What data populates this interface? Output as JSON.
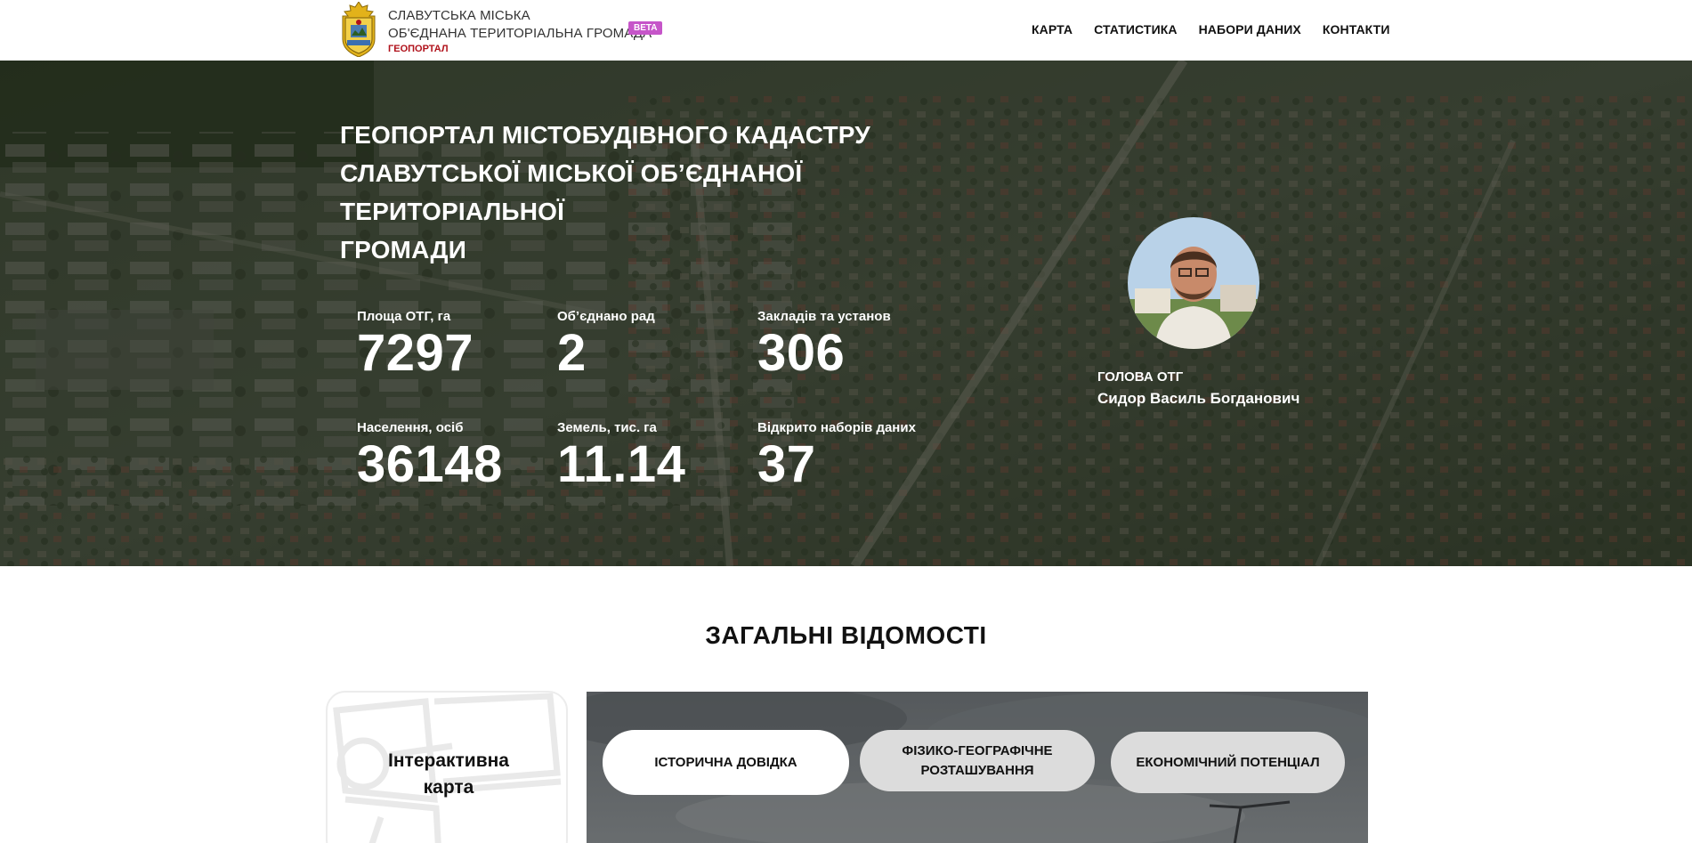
{
  "header": {
    "org_line1": "СЛАВУТСЬКА МІСЬКА",
    "org_line2": "ОБ'ЄДНАНА ТЕРИТОРІАЛЬНА ГРОМАДА",
    "org_sub": "ГЕОПОРТАЛ",
    "beta": "BETA",
    "nav": [
      "КАРТА",
      "СТАТИСТИКА",
      "НАБОРИ ДАНИХ",
      "КОНТАКТИ"
    ]
  },
  "hero": {
    "title_line1": "ГЕОПОРТАЛ МІСТОБУДІВНОГО КАДАСТРУ",
    "title_line2": "СЛАВУТСЬКОЇ МІСЬКОЇ ОБ’ЄДНАНОЇ ТЕРИТОРІАЛЬНОЇ",
    "title_line3": "ГРОМАДИ",
    "stats": [
      {
        "label": "Площа ОТГ, га",
        "value": "7297"
      },
      {
        "label": "Об’єднано рад",
        "value": "2"
      },
      {
        "label": "Закладів та установ",
        "value": "306"
      },
      {
        "label": "Населення, осіб",
        "value": "36148"
      },
      {
        "label": "Земель, тис. га",
        "value": "11.14"
      },
      {
        "label": "Відкрито наборів даних",
        "value": "37"
      }
    ],
    "head_role": "ГОЛОВА ОТГ",
    "head_name": "Сидор Василь Богданович"
  },
  "section": {
    "title": "ЗАГАЛЬНІ ВІДОМОСТІ",
    "map_card_line1": "Інтерактивна",
    "map_card_line2": "карта",
    "tabs": [
      {
        "line1": "ІСТОРИЧНА ДОВІДКА",
        "line2": ""
      },
      {
        "line1": "ФІЗИКО-ГЕОГРАФІЧНЕ",
        "line2": "РОЗТАШУВАННЯ"
      },
      {
        "line1": "ЕКОНОМІЧНИЙ ПОТЕНЦІАЛ",
        "line2": ""
      }
    ]
  },
  "colors": {
    "beta_badge": "#c655c9",
    "geoportal_red": "#b0121b",
    "hero_overlay": "#1d2318",
    "tab_inactive": "#dcdcdc"
  }
}
